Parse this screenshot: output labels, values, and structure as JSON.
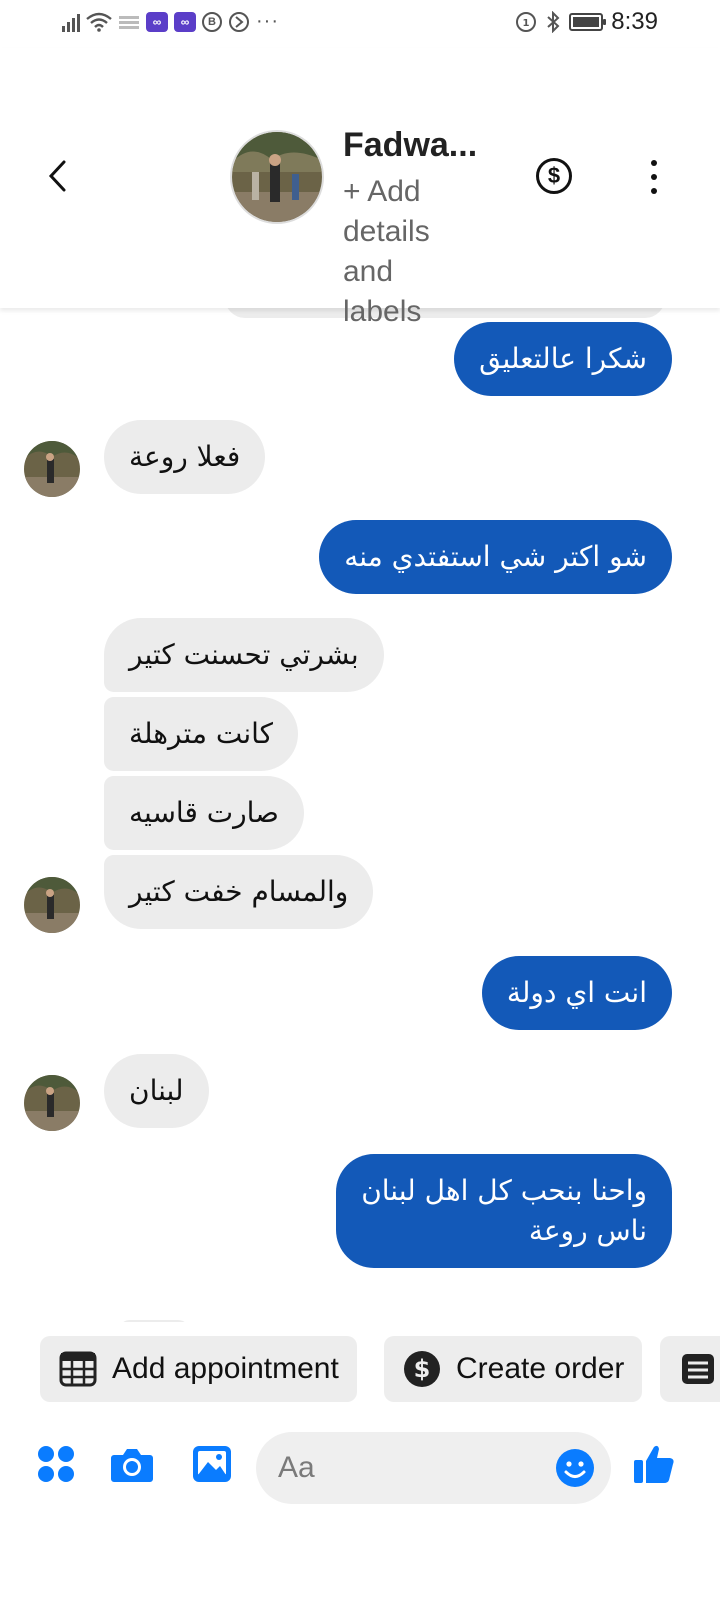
{
  "status_bar": {
    "time": "8:39",
    "badge_a": "∞",
    "badge_b": "∞",
    "badge_c": "B",
    "dots": "···"
  },
  "header": {
    "contact_name": "Fadwa...",
    "subtitle": "+ Add details and labels",
    "dollar_symbol": "$"
  },
  "messages": [
    {
      "dir": "out",
      "text": "شكرا عالتعليق"
    },
    {
      "dir": "in",
      "text": "فعلا روعة"
    },
    {
      "dir": "out",
      "text": "شو اكتر شي استفتدي منه"
    },
    {
      "dir": "in",
      "text": "بشرتي تحسنت كتير"
    },
    {
      "dir": "in",
      "text": "كانت مترهلة"
    },
    {
      "dir": "in",
      "text": "صارت قاسيه"
    },
    {
      "dir": "in",
      "text": "والمسام خفت كتير"
    },
    {
      "dir": "out",
      "text": "انت اي دولة"
    },
    {
      "dir": "in",
      "text": "لبنان"
    },
    {
      "dir": "out",
      "line1": "واحنا بنحب كل اهل لبنان",
      "line2": "ناس روعة"
    }
  ],
  "quick_actions": {
    "add_appointment": "Add appointment",
    "create_order": "Create order"
  },
  "composer": {
    "placeholder": "Aa"
  },
  "colors": {
    "outgoing_bubble": "#1359b8",
    "incoming_bubble": "#ececec",
    "accent_icons": "#0a7cff"
  },
  "icons": [
    "back-arrow-icon",
    "dollar-icon",
    "more-vertical-icon",
    "calendar-grid-icon",
    "dollar-circle-icon",
    "receipt-icon",
    "apps-grid-icon",
    "camera-icon",
    "gallery-icon",
    "emoji-icon",
    "thumbs-up-icon"
  ]
}
